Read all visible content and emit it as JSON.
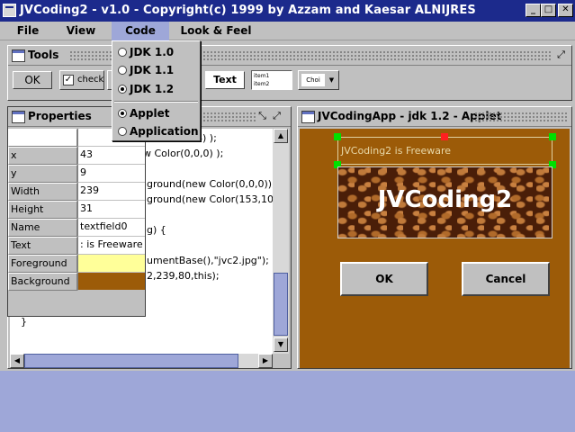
{
  "window": {
    "title": "JVCoding2 - v1.0 - Copyright(c) 1999 by Azzam and Kaesar ALNIJRES",
    "minimize_glyph": "_",
    "maximize_glyph": "□",
    "close_glyph": "✕"
  },
  "menubar": {
    "items": [
      {
        "label": "File"
      },
      {
        "label": "View"
      },
      {
        "label": "Code"
      },
      {
        "label": "Look & Feel"
      }
    ]
  },
  "code_menu": {
    "items": [
      {
        "label": "JDK 1.0",
        "selected": false
      },
      {
        "label": "JDK 1.1",
        "selected": false
      },
      {
        "label": "JDK 1.2",
        "selected": true
      },
      {
        "label": "Applet",
        "selected": true
      },
      {
        "label": "Application",
        "selected": false
      }
    ]
  },
  "tools": {
    "title": "Tools",
    "ok_label": "OK",
    "check_label": "check",
    "text_label": "Text",
    "list_items": [
      "item1",
      "item2"
    ],
    "choice_label": "Choi"
  },
  "editor": {
    "code_lines": [
      "4,204,204) );",
      "w Color(0,0,0) );",
      "",
      "ground(new Color(0,0,0));",
      "ground(new Color(153,10",
      "",
      "g) {",
      "",
      "umentBase(),\"jvc2.jpg\");",
      "2,239,80,this);"
    ],
    "closing_brace": "}"
  },
  "properties": {
    "title": "Properties",
    "rows": [
      {
        "name": "",
        "value": ""
      },
      {
        "name": "x",
        "value": "43"
      },
      {
        "name": "y",
        "value": "9"
      },
      {
        "name": "Width",
        "value": "239"
      },
      {
        "name": "Height",
        "value": "31"
      },
      {
        "name": "Name",
        "value": "textfield0"
      },
      {
        "name": "Text",
        "value": ": is Freeware"
      },
      {
        "name": "Foreground",
        "value": ""
      },
      {
        "name": "Background",
        "value": ""
      }
    ],
    "foreground_color": "#ffff99",
    "background_color": "#9c5b08"
  },
  "applet": {
    "title": "JVCodingApp - jdk 1.2 - Applet",
    "textfield_text": "JVCoding2 is Freeware",
    "banner_text": "JVCoding2",
    "ok_label": "OK",
    "cancel_label": "Cancel",
    "bg_color": "#9c5b08"
  }
}
